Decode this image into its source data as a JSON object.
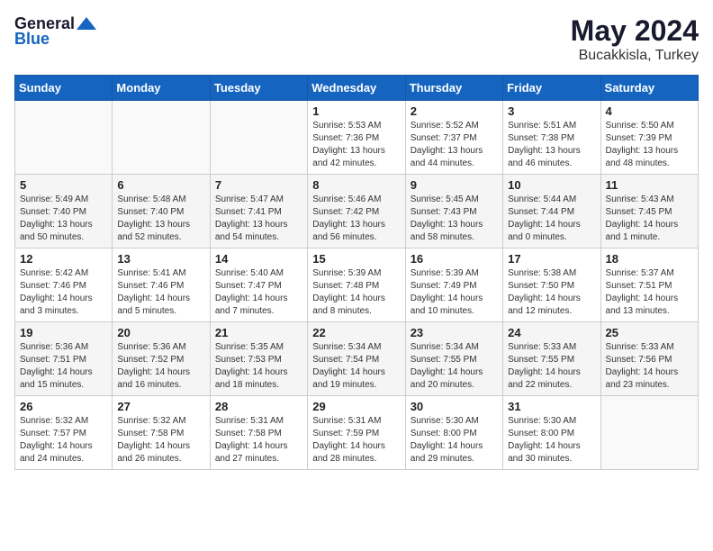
{
  "header": {
    "logo_general": "General",
    "logo_blue": "Blue",
    "title": "May 2024",
    "subtitle": "Bucakkisla, Turkey"
  },
  "days_of_week": [
    "Sunday",
    "Monday",
    "Tuesday",
    "Wednesday",
    "Thursday",
    "Friday",
    "Saturday"
  ],
  "weeks": [
    {
      "alt": false,
      "days": [
        {
          "num": "",
          "info": ""
        },
        {
          "num": "",
          "info": ""
        },
        {
          "num": "",
          "info": ""
        },
        {
          "num": "1",
          "info": "Sunrise: 5:53 AM\nSunset: 7:36 PM\nDaylight: 13 hours\nand 42 minutes."
        },
        {
          "num": "2",
          "info": "Sunrise: 5:52 AM\nSunset: 7:37 PM\nDaylight: 13 hours\nand 44 minutes."
        },
        {
          "num": "3",
          "info": "Sunrise: 5:51 AM\nSunset: 7:38 PM\nDaylight: 13 hours\nand 46 minutes."
        },
        {
          "num": "4",
          "info": "Sunrise: 5:50 AM\nSunset: 7:39 PM\nDaylight: 13 hours\nand 48 minutes."
        }
      ]
    },
    {
      "alt": true,
      "days": [
        {
          "num": "5",
          "info": "Sunrise: 5:49 AM\nSunset: 7:40 PM\nDaylight: 13 hours\nand 50 minutes."
        },
        {
          "num": "6",
          "info": "Sunrise: 5:48 AM\nSunset: 7:40 PM\nDaylight: 13 hours\nand 52 minutes."
        },
        {
          "num": "7",
          "info": "Sunrise: 5:47 AM\nSunset: 7:41 PM\nDaylight: 13 hours\nand 54 minutes."
        },
        {
          "num": "8",
          "info": "Sunrise: 5:46 AM\nSunset: 7:42 PM\nDaylight: 13 hours\nand 56 minutes."
        },
        {
          "num": "9",
          "info": "Sunrise: 5:45 AM\nSunset: 7:43 PM\nDaylight: 13 hours\nand 58 minutes."
        },
        {
          "num": "10",
          "info": "Sunrise: 5:44 AM\nSunset: 7:44 PM\nDaylight: 14 hours\nand 0 minutes."
        },
        {
          "num": "11",
          "info": "Sunrise: 5:43 AM\nSunset: 7:45 PM\nDaylight: 14 hours\nand 1 minute."
        }
      ]
    },
    {
      "alt": false,
      "days": [
        {
          "num": "12",
          "info": "Sunrise: 5:42 AM\nSunset: 7:46 PM\nDaylight: 14 hours\nand 3 minutes."
        },
        {
          "num": "13",
          "info": "Sunrise: 5:41 AM\nSunset: 7:46 PM\nDaylight: 14 hours\nand 5 minutes."
        },
        {
          "num": "14",
          "info": "Sunrise: 5:40 AM\nSunset: 7:47 PM\nDaylight: 14 hours\nand 7 minutes."
        },
        {
          "num": "15",
          "info": "Sunrise: 5:39 AM\nSunset: 7:48 PM\nDaylight: 14 hours\nand 8 minutes."
        },
        {
          "num": "16",
          "info": "Sunrise: 5:39 AM\nSunset: 7:49 PM\nDaylight: 14 hours\nand 10 minutes."
        },
        {
          "num": "17",
          "info": "Sunrise: 5:38 AM\nSunset: 7:50 PM\nDaylight: 14 hours\nand 12 minutes."
        },
        {
          "num": "18",
          "info": "Sunrise: 5:37 AM\nSunset: 7:51 PM\nDaylight: 14 hours\nand 13 minutes."
        }
      ]
    },
    {
      "alt": true,
      "days": [
        {
          "num": "19",
          "info": "Sunrise: 5:36 AM\nSunset: 7:51 PM\nDaylight: 14 hours\nand 15 minutes."
        },
        {
          "num": "20",
          "info": "Sunrise: 5:36 AM\nSunset: 7:52 PM\nDaylight: 14 hours\nand 16 minutes."
        },
        {
          "num": "21",
          "info": "Sunrise: 5:35 AM\nSunset: 7:53 PM\nDaylight: 14 hours\nand 18 minutes."
        },
        {
          "num": "22",
          "info": "Sunrise: 5:34 AM\nSunset: 7:54 PM\nDaylight: 14 hours\nand 19 minutes."
        },
        {
          "num": "23",
          "info": "Sunrise: 5:34 AM\nSunset: 7:55 PM\nDaylight: 14 hours\nand 20 minutes."
        },
        {
          "num": "24",
          "info": "Sunrise: 5:33 AM\nSunset: 7:55 PM\nDaylight: 14 hours\nand 22 minutes."
        },
        {
          "num": "25",
          "info": "Sunrise: 5:33 AM\nSunset: 7:56 PM\nDaylight: 14 hours\nand 23 minutes."
        }
      ]
    },
    {
      "alt": false,
      "days": [
        {
          "num": "26",
          "info": "Sunrise: 5:32 AM\nSunset: 7:57 PM\nDaylight: 14 hours\nand 24 minutes."
        },
        {
          "num": "27",
          "info": "Sunrise: 5:32 AM\nSunset: 7:58 PM\nDaylight: 14 hours\nand 26 minutes."
        },
        {
          "num": "28",
          "info": "Sunrise: 5:31 AM\nSunset: 7:58 PM\nDaylight: 14 hours\nand 27 minutes."
        },
        {
          "num": "29",
          "info": "Sunrise: 5:31 AM\nSunset: 7:59 PM\nDaylight: 14 hours\nand 28 minutes."
        },
        {
          "num": "30",
          "info": "Sunrise: 5:30 AM\nSunset: 8:00 PM\nDaylight: 14 hours\nand 29 minutes."
        },
        {
          "num": "31",
          "info": "Sunrise: 5:30 AM\nSunset: 8:00 PM\nDaylight: 14 hours\nand 30 minutes."
        },
        {
          "num": "",
          "info": ""
        }
      ]
    }
  ]
}
